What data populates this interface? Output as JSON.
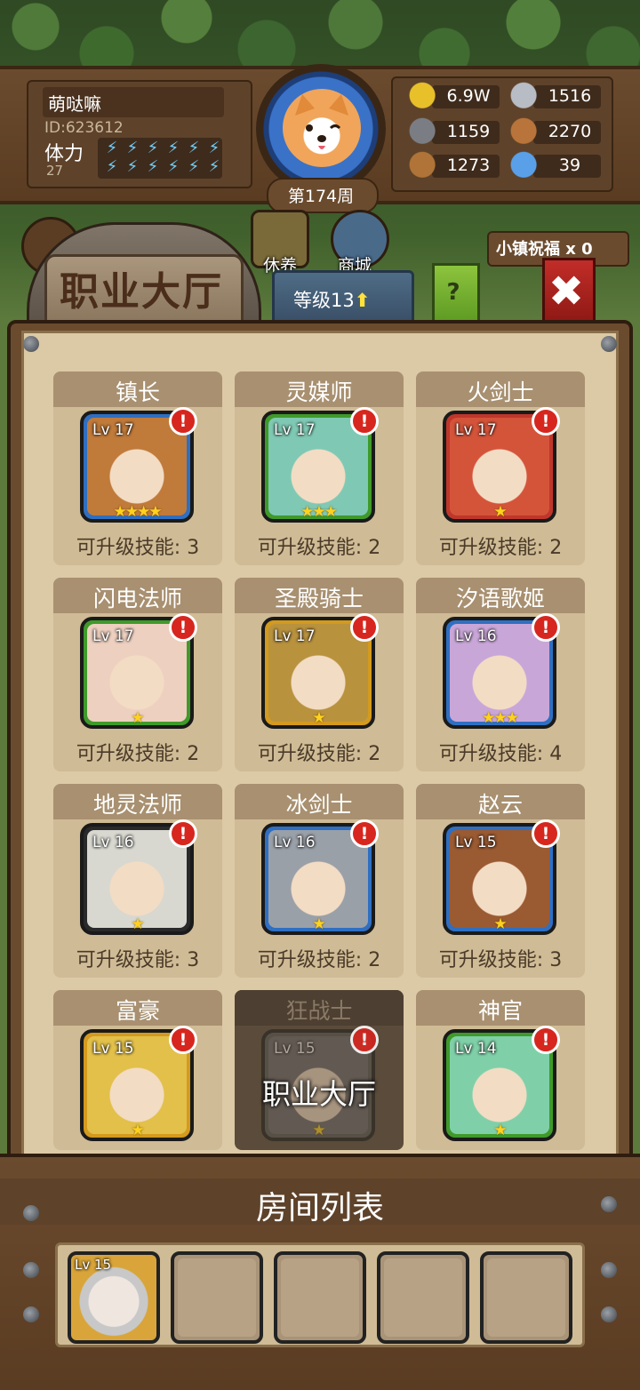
{
  "player": {
    "name": "萌哒嘛",
    "id": "ID:623612",
    "stamina_label": "体力",
    "stamina_value": "27",
    "stamina_icon": "lightning-bolt-icon",
    "week": "第174周"
  },
  "resources": [
    {
      "icon": "gold-coin-icon",
      "value": "6.9W"
    },
    {
      "icon": "iron-ingot-icon",
      "value": "1516"
    },
    {
      "icon": "stone-icon",
      "value": "1159"
    },
    {
      "icon": "leather-icon",
      "value": "2270"
    },
    {
      "icon": "wood-log-icon",
      "value": "1273"
    },
    {
      "icon": "crystal-icon",
      "value": "39"
    }
  ],
  "nav": {
    "rest_label": "休养",
    "shop_label": "商城",
    "bless_label": "小镇祝福 x 0"
  },
  "hall": {
    "title": "职业大厅",
    "level_label": "等级13",
    "help_label": "?",
    "close_label": "✖"
  },
  "classes": [
    {
      "name": "镇长",
      "level": "Lv 17",
      "stars": "★★★★",
      "skill": "可升级技能: 3",
      "frame": "#2f6fc2",
      "art": "#c07a3a"
    },
    {
      "name": "灵媒师",
      "level": "Lv 17",
      "stars": "★★★",
      "skill": "可升级技能: 2",
      "frame": "#3f9a2a",
      "art": "#7fc9b4"
    },
    {
      "name": "火剑士",
      "level": "Lv 17",
      "stars": "★",
      "skill": "可升级技能: 2",
      "frame": "#c0362a",
      "art": "#d4543a"
    },
    {
      "name": "闪电法师",
      "level": "Lv 17",
      "stars": "★",
      "skill": "可升级技能: 2",
      "frame": "#3f9a2a",
      "art": "#eed0c0"
    },
    {
      "name": "圣殿骑士",
      "level": "Lv 17",
      "stars": "★",
      "skill": "可升级技能: 2",
      "frame": "#d49a1e",
      "art": "#b9923e"
    },
    {
      "name": "汐语歌姬",
      "level": "Lv 16",
      "stars": "★★★",
      "skill": "可升级技能: 4",
      "frame": "#2f6fc2",
      "art": "#c9a6d8"
    },
    {
      "name": "地灵法师",
      "level": "Lv 16",
      "stars": "★",
      "skill": "可升级技能: 3",
      "frame": "#2a2a2a",
      "art": "#d8d8d0"
    },
    {
      "name": "冰剑士",
      "level": "Lv 16",
      "stars": "★",
      "skill": "可升级技能: 2",
      "frame": "#2f6fc2",
      "art": "#9aa0a8"
    },
    {
      "name": "赵云",
      "level": "Lv 15",
      "stars": "★",
      "skill": "可升级技能: 3",
      "frame": "#2f6fc2",
      "art": "#9a5a32"
    },
    {
      "name": "富豪",
      "level": "Lv 15",
      "stars": "★",
      "skill": "",
      "frame": "#d49a1e",
      "art": "#e2c04a"
    },
    {
      "name": "狂战士",
      "level": "Lv 15",
      "stars": "★",
      "skill": "",
      "frame": "#555",
      "art": "#6a6a6a",
      "dim_label": "职业大厅"
    },
    {
      "name": "神官",
      "level": "Lv 14",
      "stars": "★",
      "skill": "",
      "frame": "#3f9a2a",
      "art": "#7fd0a8"
    }
  ],
  "alert_mark": "!",
  "room_list": {
    "title": "房间列表",
    "slots": [
      {
        "level": "Lv 15",
        "filled": true
      },
      {
        "filled": false
      },
      {
        "filled": false
      },
      {
        "filled": false
      },
      {
        "filled": false
      }
    ]
  }
}
